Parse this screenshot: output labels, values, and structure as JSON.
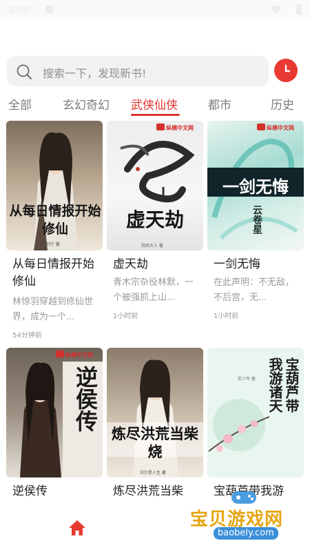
{
  "status_bar": {
    "time": "10:09"
  },
  "search": {
    "placeholder": "搜索一下，发现新书!"
  },
  "tabs": [
    {
      "label": "全部",
      "active": false
    },
    {
      "label": "玄幻奇幻",
      "active": false
    },
    {
      "label": "武侠仙侠",
      "active": true
    },
    {
      "label": "都市",
      "active": false
    },
    {
      "label": "历史",
      "active": false
    }
  ],
  "books": [
    {
      "title": "从每日情报开始修仙",
      "description": "林惊羽穿越到修仙世界，成为一个...",
      "time": "54分钟前",
      "cover": {
        "text": "从每日情报开始修仙",
        "author": "刘宁 著"
      }
    },
    {
      "title": "虚天劫",
      "description": "青木宗杂役林默，一个被强抓上山...",
      "time": "1小时前",
      "cover": {
        "text": "虚天劫",
        "author": "铁西大人 著",
        "brand": "纵横中文网"
      }
    },
    {
      "title": "一剑无悔",
      "description": "在此声明：不无敌，不后宫，无...",
      "time": "1小时前",
      "cover": {
        "text": "一剑无悔",
        "author": "云卷星",
        "brand": "纵横中文网"
      }
    },
    {
      "title": "逆侯传",
      "description": "",
      "time": "",
      "cover": {
        "text": "逆侯传",
        "brand": "纵横中文网"
      }
    },
    {
      "title": "炼尽洪荒当柴",
      "description": "",
      "time": "",
      "cover": {
        "text": "炼尽洪荒当柴烧",
        "author": "刘尔是人生 著"
      }
    },
    {
      "title": "宝葫芦带我游",
      "description": "",
      "time": "",
      "cover": {
        "text": "宝葫芦带我游诸天",
        "author": "若少年 著"
      }
    }
  ],
  "watermark": {
    "name": "宝贝游戏网",
    "url": "baobely.com"
  },
  "colors": {
    "accent": "#e2342d",
    "search_bg": "#f2f2f2",
    "muted_text": "#9a9a9a"
  },
  "icons": {
    "search": "search-icon",
    "history": "clock-icon",
    "home": "home-icon"
  }
}
